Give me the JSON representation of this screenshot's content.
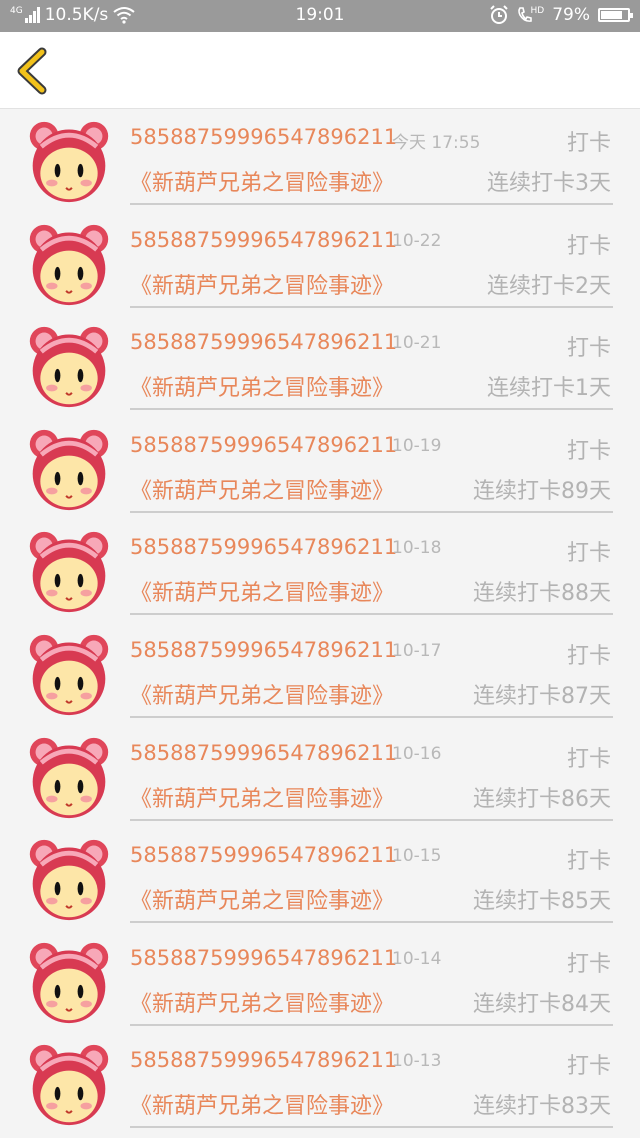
{
  "status_bar": {
    "network_type": "4G",
    "speed": "10.5K/s",
    "time": "19:01",
    "hd_label": "HD",
    "battery": "79%",
    "battery_level": 0.79
  },
  "records": [
    {
      "user_id": "5858875999654789621​1",
      "date": "今天 17:55",
      "action": "打卡",
      "title": "《新葫芦兄弟之冒险事迹》",
      "streak": "连续打卡3天"
    },
    {
      "user_id": "58588759996547896211",
      "date": "10-22",
      "action": "打卡",
      "title": "《新葫芦兄弟之冒险事迹》",
      "streak": "连续打卡2天"
    },
    {
      "user_id": "58588759996547896211",
      "date": "10-21",
      "action": "打卡",
      "title": "《新葫芦兄弟之冒险事迹》",
      "streak": "连续打卡1天"
    },
    {
      "user_id": "58588759996547896211",
      "date": "10-19",
      "action": "打卡",
      "title": "《新葫芦兄弟之冒险事迹》",
      "streak": "连续打卡89天"
    },
    {
      "user_id": "58588759996547896211",
      "date": "10-18",
      "action": "打卡",
      "title": "《新葫芦兄弟之冒险事迹》",
      "streak": "连续打卡88天"
    },
    {
      "user_id": "58588759996547896211",
      "date": "10-17",
      "action": "打卡",
      "title": "《新葫芦兄弟之冒险事迹》",
      "streak": "连续打卡87天"
    },
    {
      "user_id": "58588759996547896211",
      "date": "10-16",
      "action": "打卡",
      "title": "《新葫芦兄弟之冒险事迹》",
      "streak": "连续打卡86天"
    },
    {
      "user_id": "58588759996547896211",
      "date": "10-15",
      "action": "打卡",
      "title": "《新葫芦兄弟之冒险事迹》",
      "streak": "连续打卡85天"
    },
    {
      "user_id": "58588759996547896211",
      "date": "10-14",
      "action": "打卡",
      "title": "《新葫芦兄弟之冒险事迹》",
      "streak": "连续打卡84天"
    },
    {
      "user_id": "58588759996547896211",
      "date": "10-13",
      "action": "打卡",
      "title": "《新葫芦兄弟之冒险事迹》",
      "streak": "连续打卡83天"
    }
  ],
  "icons": {
    "back": "chevron-left-icon",
    "avatar": "cartoon-bear-avatar"
  },
  "colors": {
    "accent_orange": "#e8875a",
    "muted_gray": "#b3b3b3",
    "back_arrow": "#f2c21b",
    "status_bar_bg": "#9a9a9a"
  }
}
